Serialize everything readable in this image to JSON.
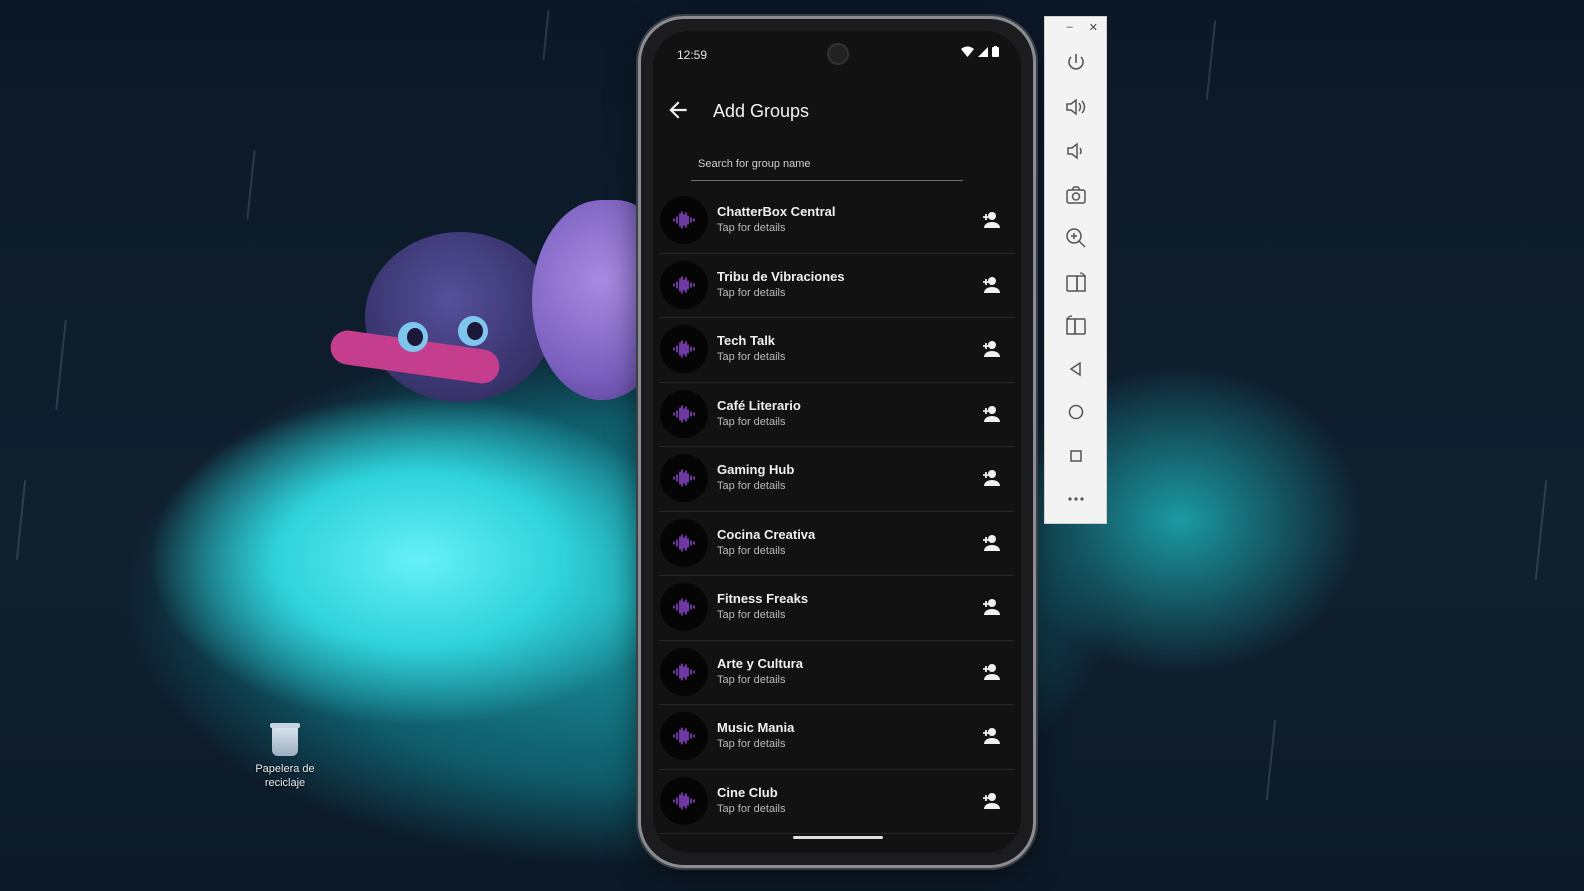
{
  "desktop": {
    "recycle_bin_label_line1": "Papelera de",
    "recycle_bin_label_line2": "reciclaje"
  },
  "phone": {
    "status_time": "12:59",
    "app_title": "Add Groups",
    "search_placeholder": "Search for group name",
    "groups": [
      {
        "name": "ChatterBox Central",
        "subtitle": "Tap for details"
      },
      {
        "name": "Tribu de Vibraciones",
        "subtitle": "Tap for details"
      },
      {
        "name": "Tech Talk",
        "subtitle": "Tap for details"
      },
      {
        "name": "Café Literario",
        "subtitle": "Tap for details"
      },
      {
        "name": "Gaming Hub",
        "subtitle": "Tap for details"
      },
      {
        "name": "Cocina Creativa",
        "subtitle": "Tap for details"
      },
      {
        "name": "Fitness Freaks",
        "subtitle": "Tap for details"
      },
      {
        "name": "Arte y Cultura",
        "subtitle": "Tap for details"
      },
      {
        "name": "Music Mania",
        "subtitle": "Tap for details"
      },
      {
        "name": "Cine Club",
        "subtitle": "Tap for details"
      }
    ]
  },
  "emulator": {
    "minimize_label": "–",
    "close_label": "✕",
    "tools": [
      "power-icon",
      "volume-up-icon",
      "volume-down-icon",
      "camera-icon",
      "zoom-in-icon",
      "rotate-left-icon",
      "rotate-right-icon",
      "back-icon",
      "home-icon",
      "overview-icon",
      "more-icon"
    ]
  },
  "colors": {
    "accent_waveform": "#a855f7",
    "screen_bg": "#121212",
    "emulator_bg": "#f3f3f3"
  }
}
